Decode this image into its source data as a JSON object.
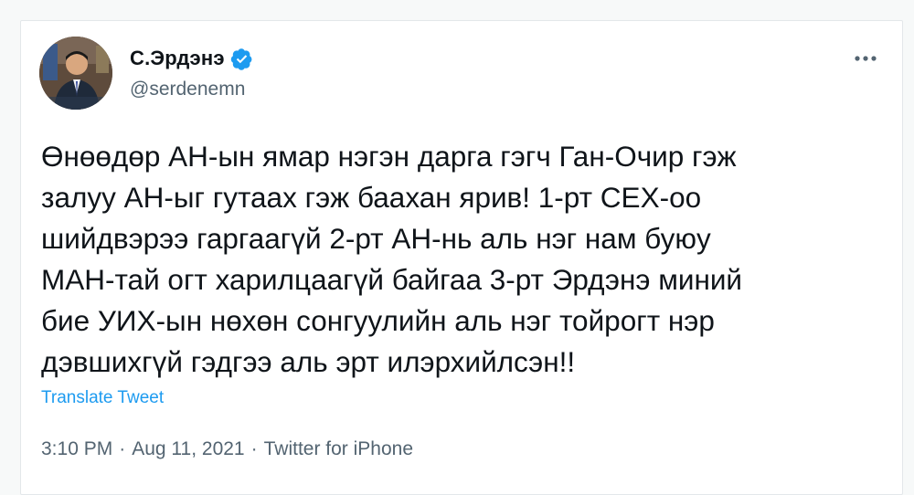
{
  "author": {
    "name": "С.Эрдэнэ",
    "handle": "@serdenemn",
    "verified": true,
    "verified_color": "#1d9bf0"
  },
  "tweet": {
    "text": "Өнөөдөр АН-ын ямар нэгэн дарга гэгч Ган-Очир гэж\nзалуу АН-ыг гутаах гэж баахан ярив! 1-рт СЕХ-оо\nшийдвэрээ гаргаагүй 2-рт АН-нь аль нэг нам буюу\nМАН-тай огт харилцаагүй байгаа 3-рт Эрдэнэ миний\nбие УИХ-ын нөхөн сонгуулийн аль нэг тойрогт нэр\nдэвшихгүй гэдгээ аль эрт илэрхийлсэн!!",
    "translate_label": "Translate Tweet"
  },
  "meta": {
    "time": "3:10 PM",
    "separator": "·",
    "date": "Aug 11, 2021",
    "source": "Twitter for iPhone"
  },
  "icons": {
    "verified": "verified-badge-icon",
    "more": "more-options-icon"
  },
  "colors": {
    "link": "#1d9bf0",
    "text": "#0f1419",
    "secondary": "#536471"
  }
}
